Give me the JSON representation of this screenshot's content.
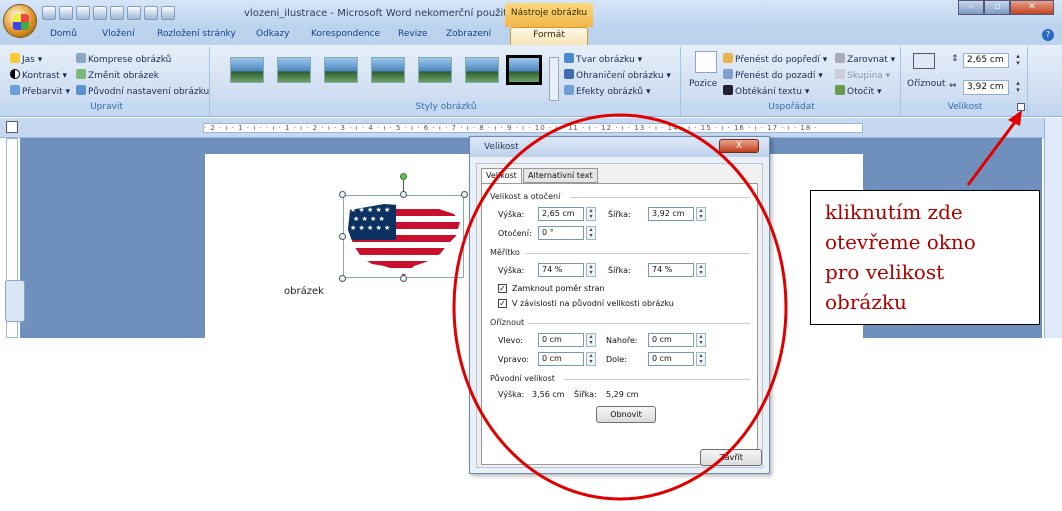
{
  "window": {
    "title": "vlozeni_ilustrace - Microsoft Word nekomerční použití",
    "context_title": "Nástroje obrázku"
  },
  "tabs": [
    "Domů",
    "Vložení",
    "Rozložení stránky",
    "Odkazy",
    "Korespondence",
    "Revize",
    "Zobrazení"
  ],
  "active_tab": "Formát",
  "ribbon": {
    "upravit": {
      "label": "Upravit",
      "items": [
        "Jas",
        "Kontrast",
        "Přebarvit",
        "Komprese obrázků",
        "Změnit obrázek",
        "Původní nastavení obrázku"
      ]
    },
    "styly": {
      "label": "Styly obrázků",
      "items": [
        "Tvar obrázku",
        "Ohraničení obrázku",
        "Efekty obrázků"
      ]
    },
    "usporadat": {
      "label": "Uspořádat",
      "pozice": "Pozice",
      "items": [
        "Přenést do popředí",
        "Přenést do pozadí",
        "Obtékání textu",
        "Zarovnat",
        "Skupina",
        "Otočit"
      ]
    },
    "velikost": {
      "label": "Velikost",
      "oriznout": "Oříznout",
      "height": "2,65 cm",
      "width": "3,92 cm"
    }
  },
  "document": {
    "word": "obrázek"
  },
  "dialog": {
    "title": "Velikost",
    "close": "X",
    "tabs": [
      "Velikost",
      "Alternativní text"
    ],
    "sections": {
      "size_rotation": "Velikost a otočení",
      "scale": "Měřítko",
      "crop": "Oříznout",
      "original": "Původní velikost"
    },
    "fields": {
      "vyska_label": "Výška:",
      "vyska": "2,65 cm",
      "sirka_label": "Šířka:",
      "sirka": "3,92 cm",
      "otoceni_label": "Otočení:",
      "otoceni": "0 °",
      "scale_vyska": "74 %",
      "scale_sirka": "74 %",
      "lock_label": "Zamknout poměr stran",
      "relative_label": "V závislosti na původní velikosti obrázku",
      "vlevo_label": "Vlevo:",
      "vlevo": "0 cm",
      "nahore_label": "Nahoře:",
      "nahore": "0 cm",
      "vpravo_label": "Vpravo:",
      "vpravo": "0 cm",
      "dole_label": "Dole:",
      "dole": "0 cm"
    },
    "original_size": {
      "vyska_label": "Výška:",
      "vyska": "3,56 cm",
      "sirka_label": "Šířka:",
      "sirka": "5,29 cm"
    },
    "reset_button": "Obnovit",
    "close_button": "Zavřít"
  },
  "annotation": {
    "text_lines": [
      "kliknutím zde",
      "otevřeme okno",
      "pro velikost",
      "obrázku"
    ],
    "color": "#cc0000"
  },
  "ruler": {
    "text": "· 2 · ı · 1 · ı ·   · ı · 1 · ı · 2 · ı · 3 · ı · 4 · ı · 5 · ı · 6 · ı · 7 · ı · 8 · ı · 9 · ı · 10 · ı · 11 · ı · 12 · ı · 13 · ı · 14 · ı · 15 · ı · 16 · ı · 17 · ı · 18 ·"
  }
}
